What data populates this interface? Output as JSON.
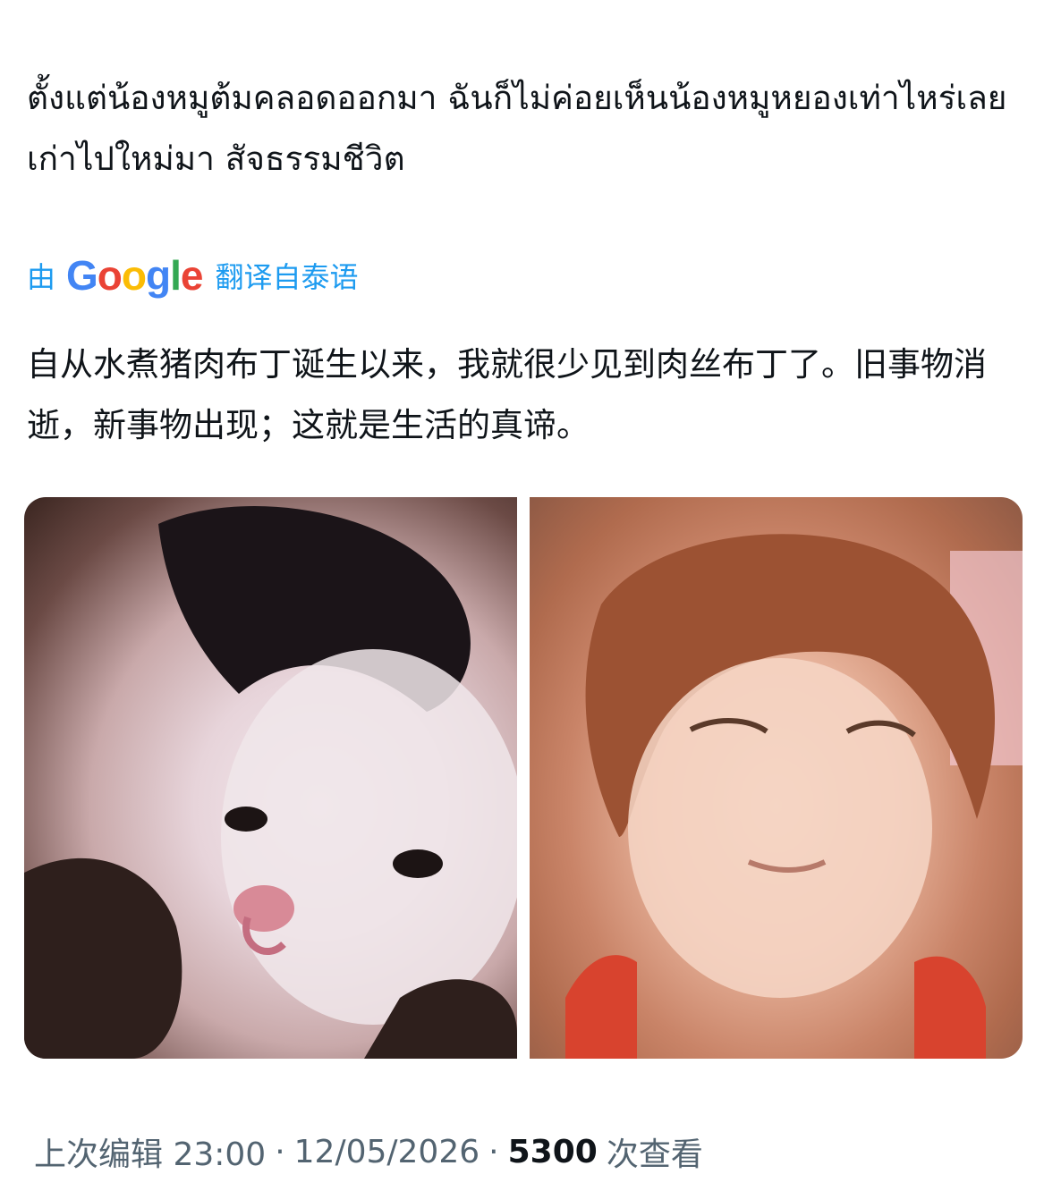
{
  "tweet": {
    "original_text": "ตั้งแต่น้องหมูต้มคลอดออกมา ฉันก็ไม่ค่อยเห็นน้องหมูหยองเท่าไหร่เลย เก่าไปใหม่มา สัจธรรมชีวิต",
    "translation_prefix": "由",
    "translation_provider": "Google",
    "translation_suffix": "翻译自泰语",
    "translated_text": "自从水煮猪肉布丁诞生以来，我就很少见到肉丝布丁了。旧事物消逝，新事物出现；这就是生活的真谛。"
  },
  "media": [
    {
      "icon": "child-photo-playful"
    },
    {
      "icon": "child-photo-eyes-closed"
    }
  ],
  "meta": {
    "edited_label": "上次编辑 23:00",
    "separator": "·",
    "date": "12/05/2026",
    "views_count": "5300",
    "views_label": "次查看"
  },
  "colors": {
    "text": "#0f1419",
    "link": "#1d9bf0",
    "muted": "#536471"
  }
}
